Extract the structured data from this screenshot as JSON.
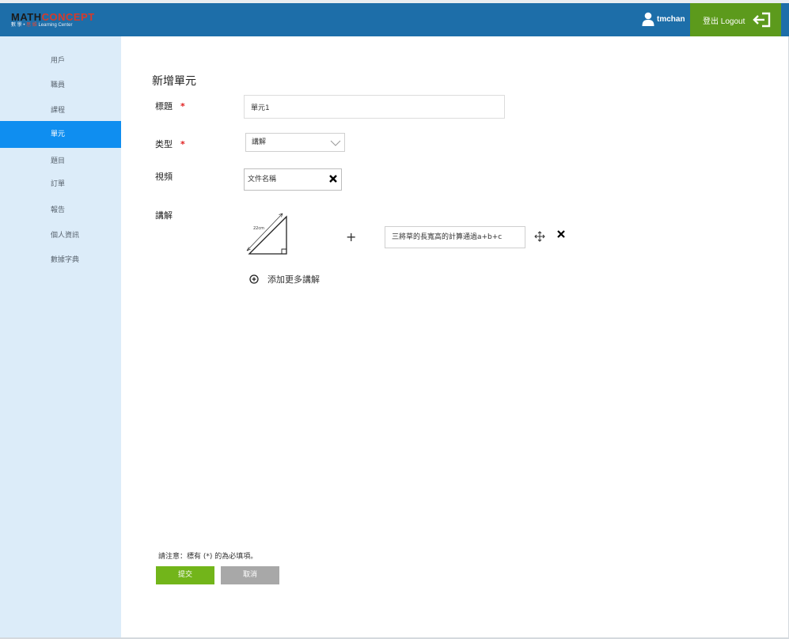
{
  "brand": {
    "name_part1": "MATH",
    "name_part2": "CONCEPT",
    "tagline_prefix": "數 學 • ",
    "tagline_red": "思 維",
    "tagline_suffix": " Learning Center",
    "colors": {
      "bar": "#1d6ea9",
      "accent": "#0f8ef0",
      "logout": "#5c9a1c",
      "submit": "#72b51a",
      "required": "#e01e1e"
    }
  },
  "header": {
    "username": "tmchan",
    "logout_label": "登出 Logout",
    "user_icon": "user-icon",
    "logout_icon": "logout-icon"
  },
  "sidebar": {
    "items": [
      {
        "label": "用戶",
        "active": false
      },
      {
        "label": "職員",
        "active": false
      },
      {
        "label": "課程",
        "active": false
      },
      {
        "label": "單元",
        "active": true
      },
      {
        "label": "題目",
        "active": false
      },
      {
        "label": "訂單",
        "active": false
      },
      {
        "label": "報告",
        "active": false
      },
      {
        "label": "個人資訊",
        "active": false
      },
      {
        "label": "數據字典",
        "active": false
      }
    ]
  },
  "form": {
    "page_title": "新增單元",
    "title_label": "標題",
    "title_value": "單元1",
    "type_label": "类型",
    "type_value": "講解",
    "video_label": "視頻",
    "video_value": "文件名稱",
    "explain_label": "講解",
    "explain_text": "三將草的長寬高的計算通過a+b+c",
    "diagram_label": "22cm",
    "plus_sign": "+",
    "add_more_label": "添加更多講解",
    "required_mark": "*"
  },
  "footer": {
    "note": "請注意：標有 (*) 的為必填項。",
    "submit_label": "提交",
    "cancel_label": "取消"
  }
}
